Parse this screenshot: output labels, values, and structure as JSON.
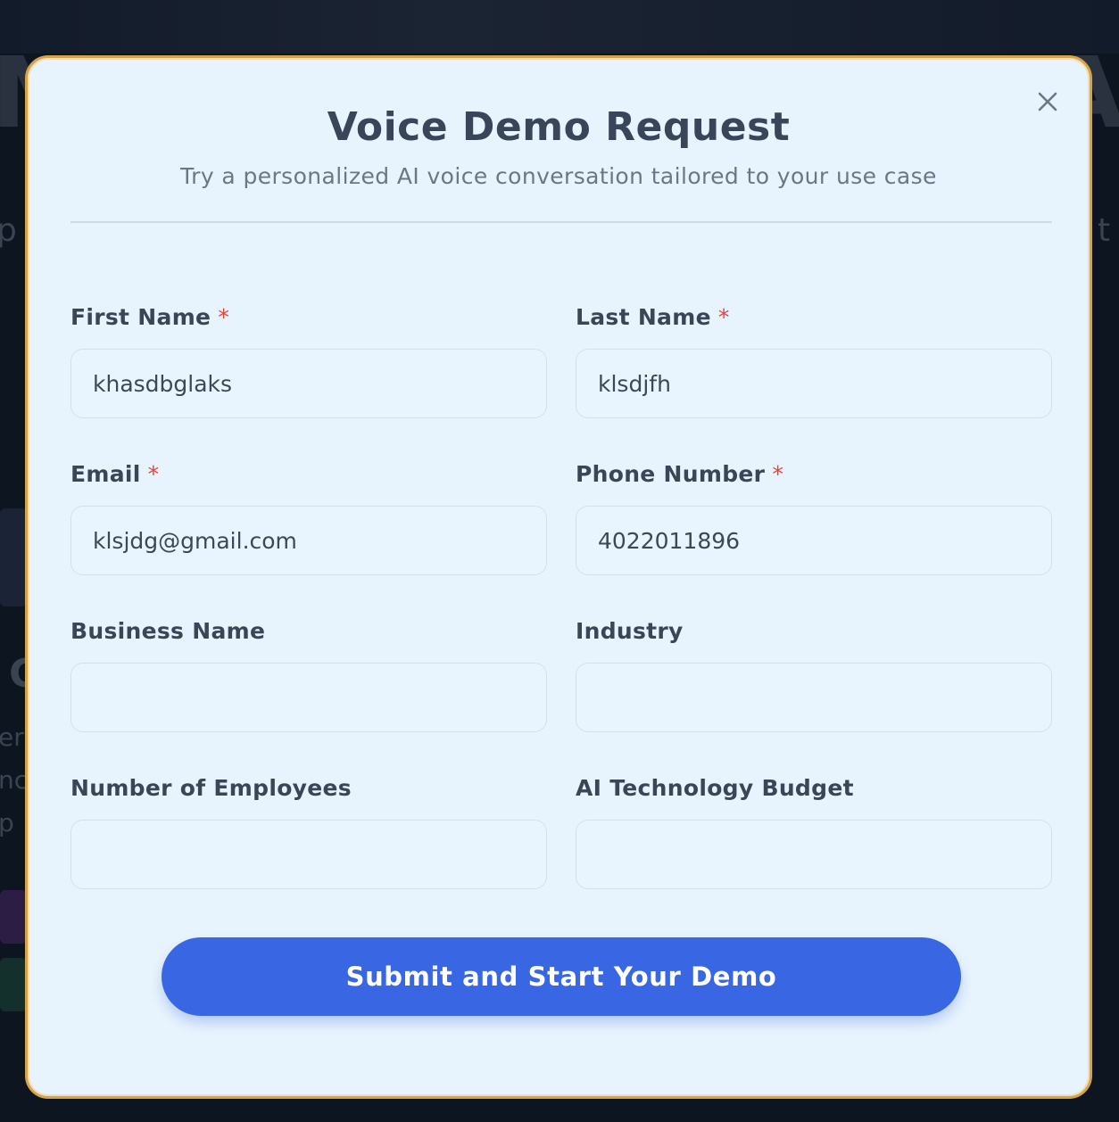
{
  "modal": {
    "title": "Voice Demo Request",
    "subtitle": "Try a personalized AI voice conversation tailored to your use case",
    "close_icon": "close-icon"
  },
  "form": {
    "first_name": {
      "label": "First Name",
      "required_mark": "*",
      "value": "khasdbglaks"
    },
    "last_name": {
      "label": "Last Name",
      "required_mark": "*",
      "value": "klsdjfh"
    },
    "email": {
      "label": "Email",
      "required_mark": "*",
      "value": "klsjdg@gmail.com"
    },
    "phone": {
      "label": "Phone Number",
      "required_mark": "*",
      "value": "4022011896"
    },
    "business_name": {
      "label": "Business Name",
      "value": ""
    },
    "industry": {
      "label": "Industry",
      "value": ""
    },
    "employees": {
      "label": "Number of Employees",
      "value": ""
    },
    "budget": {
      "label": "AI Technology Budget",
      "value": ""
    },
    "submit_label": "Submit and Start Your Demo"
  },
  "colors": {
    "modal_background": "#e8f4fd",
    "modal_border": "#d6a34a",
    "required": "#e0463c",
    "primary_button": "#3966e3",
    "title_text": "#39465a"
  }
}
